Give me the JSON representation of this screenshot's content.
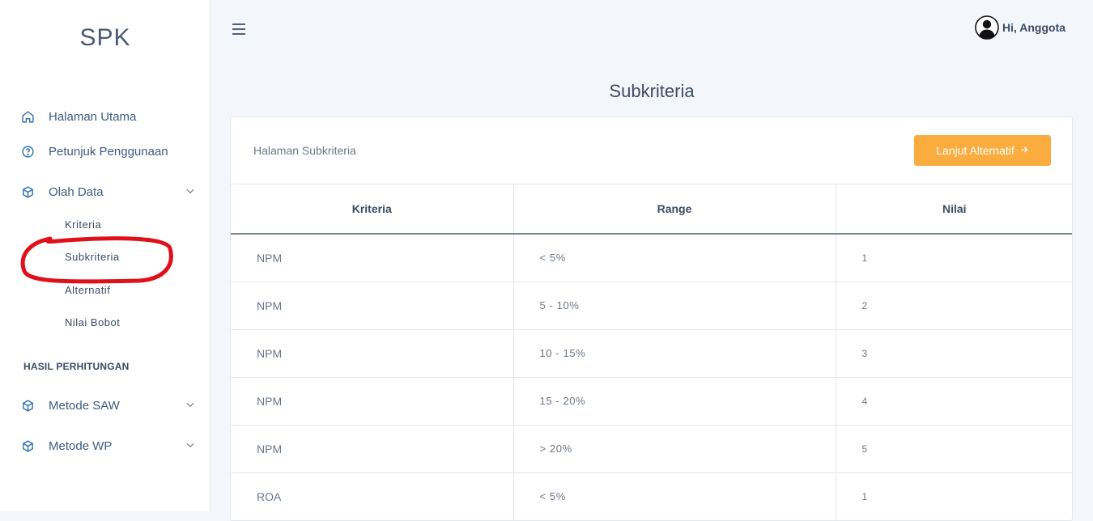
{
  "sidebar": {
    "brand": "SPK",
    "items": [
      {
        "label": "Halaman Utama",
        "icon": "home-icon"
      },
      {
        "label": "Petunjuk Penggunaan",
        "icon": "help-circle-icon"
      },
      {
        "label": "Olah Data",
        "icon": "box-icon"
      }
    ],
    "olah_data_sub": [
      "Kriteria",
      "Subkriteria",
      "Alternatif",
      "Nilai Bobot"
    ],
    "section_heading": "HASIL PERHITUNGAN",
    "hasil_items": [
      {
        "label": "Metode SAW",
        "icon": "box-icon"
      },
      {
        "label": "Metode WP",
        "icon": "box-icon"
      }
    ]
  },
  "header": {
    "user_greeting": "Hi, Anggota"
  },
  "main": {
    "page_title": "Subkriteria",
    "card_subtitle": "Halaman Subkriteria",
    "next_button_label": "Lanjut Alternatif",
    "table": {
      "columns": [
        "Kriteria",
        "Range",
        "Nilai"
      ],
      "rows": [
        {
          "kriteria": "NPM",
          "range": "< 5%",
          "nilai": "1"
        },
        {
          "kriteria": "NPM",
          "range": "5 - 10%",
          "nilai": "2"
        },
        {
          "kriteria": "NPM",
          "range": "10 - 15%",
          "nilai": "3"
        },
        {
          "kriteria": "NPM",
          "range": "15 - 20%",
          "nilai": "4"
        },
        {
          "kriteria": "NPM",
          "range": "> 20%",
          "nilai": "5"
        },
        {
          "kriteria": "ROA",
          "range": "< 5%",
          "nilai": "1"
        }
      ]
    }
  },
  "colors": {
    "accent_button": "#fbac3f",
    "annotation_circle": "#e0101a",
    "nav_icon": "#2f6fb0"
  }
}
